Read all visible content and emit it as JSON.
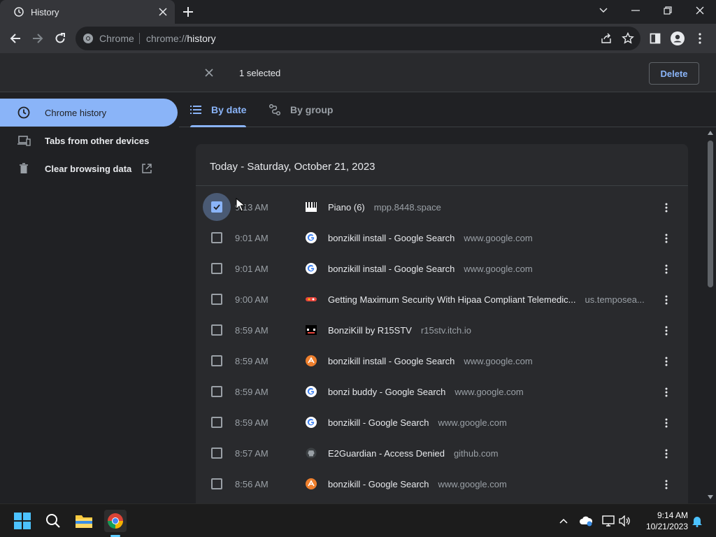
{
  "browser": {
    "tab_title": "History",
    "omnibox_chip": "Chrome",
    "url_prefix": "chrome://",
    "url_host": "history"
  },
  "selection": {
    "count_text": "1 selected",
    "delete_label": "Delete"
  },
  "sidebar": {
    "items": [
      {
        "label": "Chrome history",
        "icon": "clock-icon",
        "active": true
      },
      {
        "label": "Tabs from other devices",
        "icon": "devices-icon",
        "active": false
      },
      {
        "label": "Clear browsing data",
        "icon": "trash-icon",
        "active": false
      }
    ]
  },
  "view_tabs": [
    {
      "label": "By date",
      "active": true
    },
    {
      "label": "By group",
      "active": false
    }
  ],
  "history": {
    "date_heading": "Today - Saturday, October 21, 2023",
    "rows": [
      {
        "time": "9:13 AM",
        "title": "Piano (6)",
        "domain": "mpp.8448.space",
        "favicon": "piano-favicon",
        "checked": true
      },
      {
        "time": "9:01 AM",
        "title": "bonzikill install - Google Search",
        "domain": "www.google.com",
        "favicon": "google-favicon",
        "checked": false
      },
      {
        "time": "9:01 AM",
        "title": "bonzikill install - Google Search",
        "domain": "www.google.com",
        "favicon": "google-favicon",
        "checked": false
      },
      {
        "time": "9:00 AM",
        "title": "Getting Maximum Security With Hipaa Compliant Telemedic...",
        "domain": "us.temposea...",
        "favicon": "tempo-favicon",
        "checked": false
      },
      {
        "time": "8:59 AM",
        "title": "BonziKill by R15STV",
        "domain": "r15stv.itch.io",
        "favicon": "itch-favicon",
        "checked": false
      },
      {
        "time": "8:59 AM",
        "title": "bonzikill install - Google Search",
        "domain": "www.google.com",
        "favicon": "orange-search-favicon",
        "checked": false
      },
      {
        "time": "8:59 AM",
        "title": "bonzi buddy - Google Search",
        "domain": "www.google.com",
        "favicon": "google-favicon",
        "checked": false
      },
      {
        "time": "8:59 AM",
        "title": "bonzikill - Google Search",
        "domain": "www.google.com",
        "favicon": "google-favicon",
        "checked": false
      },
      {
        "time": "8:57 AM",
        "title": "E2Guardian - Access Denied",
        "domain": "github.com",
        "favicon": "github-favicon",
        "checked": false
      },
      {
        "time": "8:56 AM",
        "title": "bonzikill - Google Search",
        "domain": "www.google.com",
        "favicon": "orange-search-favicon",
        "checked": false
      }
    ]
  },
  "taskbar": {
    "time": "9:14 AM",
    "date": "10/21/2023"
  },
  "colors": {
    "accent": "#8ab4f8",
    "background": "#202124",
    "card": "#292a2d"
  }
}
